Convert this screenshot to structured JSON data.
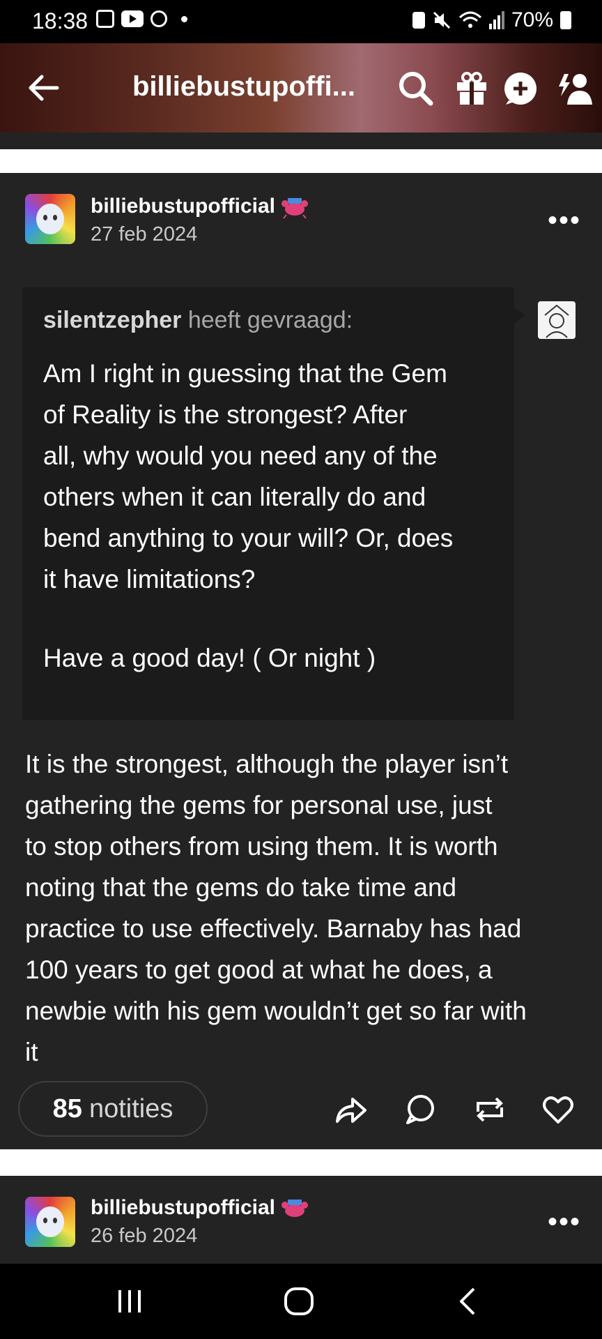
{
  "status_bar": {
    "time": "18:38",
    "battery": "70%"
  },
  "header": {
    "title": "billiebustupoffi..."
  },
  "posts": [
    {
      "username": "billiebustupofficial",
      "date": "27 feb 2024",
      "ask": {
        "asker": "silentzepher",
        "asked_label": "heeft gevraagd:",
        "question_lines": [
          "Am I right in guessing that the Gem",
          "of Reality is the strongest? After",
          "all, why would you need any of the",
          "others when it can literally do and",
          "bend anything to your will? Or, does",
          "it have limitations?"
        ],
        "signoff": "Have a good day! ( Or night )"
      },
      "answer_lines": [
        "It is the strongest, although the player isn’t",
        "gathering the gems for personal use, just",
        "to stop others from using them. It is worth",
        "noting that the gems do take time and",
        "practice to use effectively. Barnaby has had",
        "100 years to get good at what he does, a",
        "newbie with his gem wouldn’t get so far with",
        "it"
      ],
      "notes_count": "85",
      "notes_label": "notities"
    },
    {
      "username": "billiebustupofficial",
      "date": "26 feb 2024"
    }
  ],
  "icons": {
    "back": "arrow-left-icon",
    "search": "search-icon",
    "gift": "gift-icon",
    "add": "plus-bubble-icon",
    "follow": "follow-user-icon",
    "share": "share-icon",
    "reply": "reply-icon",
    "reblog": "reblog-icon",
    "like": "heart-icon"
  },
  "colors": {
    "post_bg": "#232323",
    "ask_bg": "#1b1b1b",
    "divider": "#ffffff"
  }
}
